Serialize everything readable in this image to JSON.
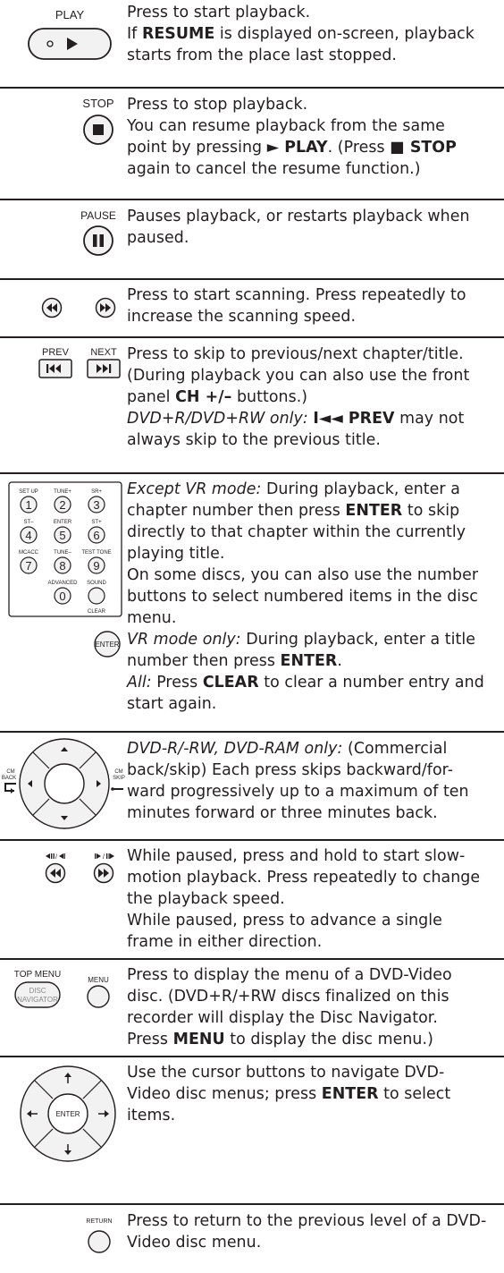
{
  "rows": [
    {
      "icon": "play-button",
      "icon_label": "PLAY",
      "lines": [
        [
          {
            "t": "Press to start playback."
          }
        ],
        [
          {
            "t": "If "
          },
          {
            "t": "RESUME",
            "s": "b"
          },
          {
            "t": " is displayed on-screen, playback"
          }
        ],
        [
          {
            "t": "starts from the place last stopped."
          }
        ]
      ]
    },
    {
      "icon": "stop-button",
      "icon_label": "STOP",
      "lines": [
        [
          {
            "t": "Press to stop playback."
          }
        ],
        [
          {
            "t": "You can resume playback from the same"
          }
        ],
        [
          {
            "t": "point by pressing "
          },
          {
            "t": "► PLAY",
            "s": "b"
          },
          {
            "t": ". (Press "
          },
          {
            "t": "■ STOP",
            "s": "b"
          }
        ],
        [
          {
            "t": "again to cancel the resume function.)"
          }
        ]
      ]
    },
    {
      "icon": "pause-button",
      "icon_label": "PAUSE",
      "lines": [
        [
          {
            "t": "Pauses playback, or restarts playback when"
          }
        ],
        [
          {
            "t": "paused."
          }
        ]
      ]
    },
    {
      "icon": "scan-buttons",
      "lines": [
        [
          {
            "t": "Press to start scanning. Press repeatedly to"
          }
        ],
        [
          {
            "t": "increase the scanning speed."
          }
        ]
      ]
    },
    {
      "icon": "skip-buttons",
      "icon_labels": [
        "PREV",
        "NEXT"
      ],
      "lines": [
        [
          {
            "t": "Press to skip to previous/next chapter/title."
          }
        ],
        [
          {
            "t": "(During playback you can also use the front"
          }
        ],
        [
          {
            "t": "panel "
          },
          {
            "t": "CH +/–",
            "s": "b"
          },
          {
            "t": " buttons.)"
          }
        ],
        [
          {
            "t": "DVD+R/DVD+RW only:",
            "s": "i"
          },
          {
            "t": " "
          },
          {
            "t": "I◄◄ PREV",
            "s": "b"
          },
          {
            "t": " may not"
          }
        ],
        [
          {
            "t": "always skip to the previous title."
          }
        ]
      ]
    },
    {
      "icon": "number-keypad",
      "keypad_labels": [
        "SET UP",
        "TUNE+",
        "SR+",
        "ST–",
        "ENTER",
        "ST+",
        "MCACC",
        "TUNE–",
        "TEST TONE",
        "ADVANCED",
        "SOUND",
        "CLEAR"
      ],
      "keypad_digits": [
        "1",
        "2",
        "3",
        "4",
        "5",
        "6",
        "7",
        "8",
        "9",
        "0"
      ],
      "enter_label": "ENTER",
      "lines": [
        [
          {
            "t": "Except VR mode:",
            "s": "i"
          },
          {
            "t": " During playback, enter a"
          }
        ],
        [
          {
            "t": "chapter number then press "
          },
          {
            "t": "ENTER",
            "s": "b"
          },
          {
            "t": " to skip"
          }
        ],
        [
          {
            "t": "directly to that chapter within the currently"
          }
        ],
        [
          {
            "t": "playing title."
          }
        ],
        [
          {
            "t": "On some discs, you can also use the number"
          }
        ],
        [
          {
            "t": "buttons to select numbered items in the disc"
          }
        ],
        [
          {
            "t": "menu."
          }
        ],
        [
          {
            "t": "VR mode only:",
            "s": "i"
          },
          {
            "t": " During playback, enter a title"
          }
        ],
        [
          {
            "t": "number then press "
          },
          {
            "t": "ENTER",
            "s": "b"
          },
          {
            "t": "."
          }
        ],
        [
          {
            "t": "All:",
            "s": "i"
          },
          {
            "t": " Press "
          },
          {
            "t": "CLEAR",
            "s": "b"
          },
          {
            "t": " to clear a number entry and"
          }
        ],
        [
          {
            "t": "start again."
          }
        ]
      ]
    },
    {
      "icon": "cm-back-skip-dial",
      "dial_labels": [
        "CM",
        "BACK",
        "CM",
        "SKIP"
      ],
      "lines": [
        [
          {
            "t": "DVD-R/-RW, DVD-RAM only:",
            "s": "i"
          },
          {
            "t": " (Commercial"
          }
        ],
        [
          {
            "t": "back/skip) Each press skips backward/for-"
          }
        ],
        [
          {
            "t": "ward progressively up to a maximum of ten"
          }
        ],
        [
          {
            "t": "minutes forward or three minutes back."
          }
        ]
      ]
    },
    {
      "icon": "slow-step-buttons",
      "lines": [
        [
          {
            "t": "While paused, press and hold to start slow-"
          }
        ],
        [
          {
            "t": "motion playback. Press repeatedly to change"
          }
        ],
        [
          {
            "t": "the playback speed."
          }
        ],
        [
          {
            "t": "While paused, press to advance a single"
          }
        ],
        [
          {
            "t": "frame in either direction."
          }
        ]
      ]
    },
    {
      "icon": "menu-buttons",
      "icon_labels": [
        "TOP MENU",
        "DISC",
        "NAVIGATOR",
        "MENU"
      ],
      "lines": [
        [
          {
            "t": "Press to display the menu of a DVD-Video"
          }
        ],
        [
          {
            "t": "disc. (DVD+R/+RW discs finalized on this"
          }
        ],
        [
          {
            "t": "recorder will display the Disc Navigator."
          }
        ],
        [
          {
            "t": "Press "
          },
          {
            "t": "MENU",
            "s": "b"
          },
          {
            "t": " to display the disc menu.)"
          }
        ]
      ]
    },
    {
      "icon": "cursor-enter-dial",
      "dial_center_label": "ENTER",
      "lines": [
        [
          {
            "t": "Use the cursor buttons to navigate DVD-"
          }
        ],
        [
          {
            "t": "Video disc menus; press "
          },
          {
            "t": "ENTER",
            "s": "b"
          },
          {
            "t": " to select"
          }
        ],
        [
          {
            "t": "items."
          }
        ]
      ]
    },
    {
      "icon": "return-button",
      "icon_label": "RETURN",
      "lines": [
        [
          {
            "t": "Press to return to the previous level of a DVD-"
          }
        ],
        [
          {
            "t": "Video disc menu."
          }
        ]
      ]
    }
  ]
}
